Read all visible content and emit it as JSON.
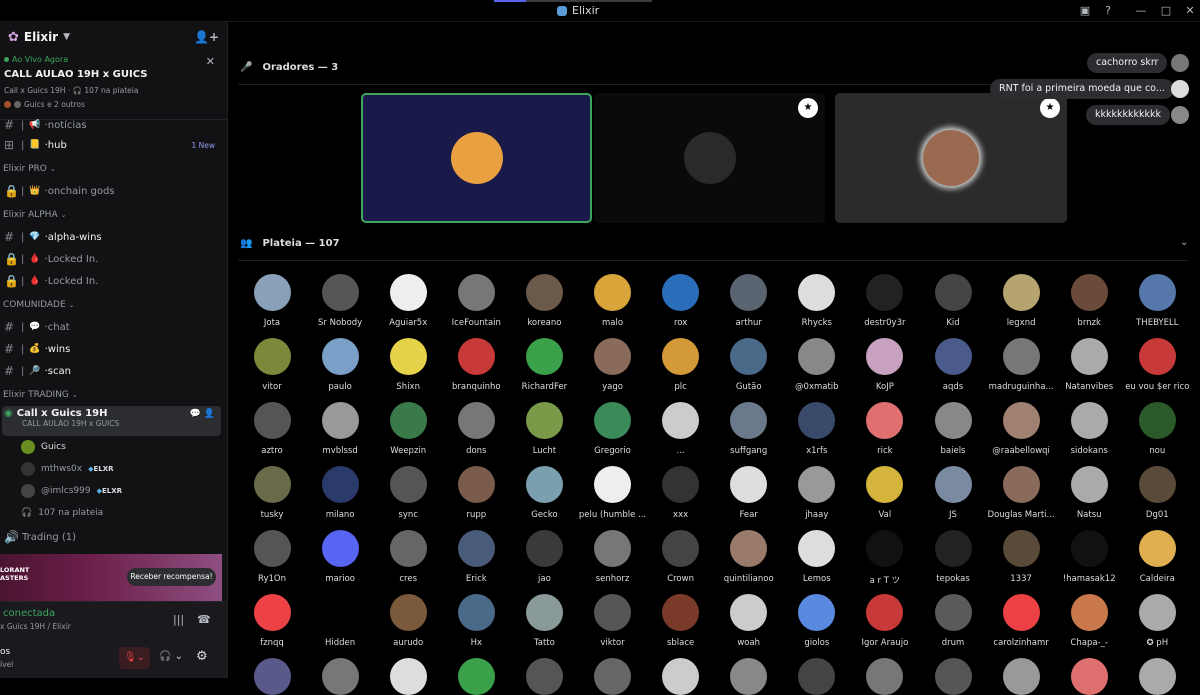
{
  "window": {
    "title": "Elixir",
    "min_icon": "minimize-icon",
    "max_icon": "maximize-icon",
    "close_icon": "close-icon",
    "help_icon": "help-icon"
  },
  "server": {
    "name": "Elixir"
  },
  "live_banner": {
    "label": "Ao Vivo Agora",
    "title": "CALL AULAO 19H x GUICS",
    "meta": "Call x Guics 19H  ·  🎧 107 na plateia",
    "meta2": "Guics e 2 outros"
  },
  "channels_top": [
    {
      "name": "notícias",
      "emoji": "📢"
    },
    {
      "name": "hub",
      "emoji": "📒",
      "badge": "1 New"
    }
  ],
  "cat_pro": {
    "name": "Elixir PRO"
  },
  "ch_pro": [
    {
      "name": "onchain gods",
      "emoji": "👑"
    }
  ],
  "cat_alpha": {
    "name": "Elixir ALPHA"
  },
  "ch_alpha": [
    {
      "name": "alpha-wins",
      "emoji": "💎"
    },
    {
      "name": "Locked In.",
      "emoji": "🩸"
    },
    {
      "name": "Locked In.",
      "emoji": "🩸"
    }
  ],
  "cat_com": {
    "name": "COMUNIDADE"
  },
  "ch_com": [
    {
      "name": "chat",
      "emoji": "💬"
    },
    {
      "name": "wins",
      "emoji": "💰"
    },
    {
      "name": "scan",
      "emoji": "🔎"
    }
  ],
  "cat_trading": {
    "name": "Elixir TRADING"
  },
  "voice_channel": {
    "name": "Call x Guics 19H",
    "sub": "CALL AULAO 19H x GUICS"
  },
  "voice_users": [
    {
      "name": "Guics",
      "tag": "",
      "color": "#6b8e23"
    },
    {
      "name": "mthws0x",
      "tag": "ELXR",
      "color": "#333"
    },
    {
      "name": "@imlcs999",
      "tag": "ELXR",
      "color": "#444"
    }
  ],
  "audience_count": "107 na plateia",
  "trading_channel": "Trading (1)",
  "promo": {
    "text": "LORANT\nASTERS",
    "button": "Receber recompensa!"
  },
  "connection": {
    "status": "conectada",
    "detail": "x Guics 19H / Elixir"
  },
  "user": {
    "name": "os",
    "status": "ível"
  },
  "speakers_header": "Oradores — 3",
  "audience_header": "Plateia — 107",
  "chat": [
    {
      "text": "cachorro skrr",
      "color": "#777"
    },
    {
      "text": "RNT foi a primeira moeda que co...",
      "color": "#ddd"
    },
    {
      "text": "kkkkkkkkkkkk",
      "color": "#888"
    }
  ],
  "audience": [
    [
      "Jota",
      "#8aa0b8"
    ],
    [
      "Sr Nobody",
      "#555"
    ],
    [
      "Aguiar5x",
      "#eee"
    ],
    [
      "IceFountain",
      "#777"
    ],
    [
      "koreano",
      "#6b5a4a"
    ],
    [
      "malo",
      "#d9a53a"
    ],
    [
      "rox",
      "#2a6ebb"
    ],
    [
      "arthur",
      "#5a6470"
    ],
    [
      "Rhycks",
      "#ddd"
    ],
    [
      "destr0y3r",
      "#222"
    ],
    [
      "Kid",
      "#444"
    ],
    [
      "legxnd",
      "#b5a470"
    ],
    [
      "brnzk",
      "#6a4a3a"
    ],
    [
      "THEBYELL",
      "#5577aa"
    ],
    [
      "vitor",
      "#7a8a3a"
    ],
    [
      "paulo",
      "#7aa0c8"
    ],
    [
      "Shixn",
      "#e6d24a"
    ],
    [
      "branquinho",
      "#c83a3a"
    ],
    [
      "RichardFer",
      "#3aa04a"
    ],
    [
      "yago",
      "#8a6a5a"
    ],
    [
      "plc",
      "#d49a3a"
    ],
    [
      "Gutão",
      "#4a6a8a"
    ],
    [
      "@0xmatib",
      "#888"
    ],
    [
      "KoJP",
      "#c8a0c0"
    ],
    [
      "aqds",
      "#4a5a8a"
    ],
    [
      "madruguinha...",
      "#777"
    ],
    [
      "Natanvibes",
      "#aaa"
    ],
    [
      "eu vou $er rico",
      "#c83a3a"
    ],
    [
      "aztro",
      "#555"
    ],
    [
      "mvblssd",
      "#999"
    ],
    [
      "Weepzin",
      "#3a7a4a"
    ],
    [
      "dons",
      "#777"
    ],
    [
      "Lucht",
      "#7a9a4a"
    ],
    [
      "Gregorio",
      "#3a8a5a"
    ],
    [
      "...",
      "#ccc"
    ],
    [
      "suffgang",
      "#6a7a8a"
    ],
    [
      "x1rfs",
      "#3a4a6a"
    ],
    [
      "rick",
      "#e07070"
    ],
    [
      "baiels",
      "#888"
    ],
    [
      "@raabellowqi",
      "#a08070"
    ],
    [
      "sidokans",
      "#aaa"
    ],
    [
      "nou",
      "#2a5a2a"
    ],
    [
      "tusky",
      "#6a6a4a"
    ],
    [
      "milano",
      "#2a3a6a"
    ],
    [
      "sync",
      "#555"
    ],
    [
      "rupp",
      "#7a5a4a"
    ],
    [
      "Gecko",
      "#7aa0b0"
    ],
    [
      "pelu (humble ...",
      "#eee"
    ],
    [
      "xxx",
      "#333"
    ],
    [
      "Fear",
      "#ddd"
    ],
    [
      "jhaay",
      "#999"
    ],
    [
      "Val",
      "#d4b43a"
    ],
    [
      "JS",
      "#7a8aa0"
    ],
    [
      "Douglas Marti...",
      "#8a6a5a"
    ],
    [
      "Natsu",
      "#aaa"
    ],
    [
      "Dg01",
      "#5a4a3a"
    ],
    [
      "Ry1On",
      "#555"
    ],
    [
      "marioo",
      "#5865f2"
    ],
    [
      "cres",
      "#666"
    ],
    [
      "Erick",
      "#4a5a7a"
    ],
    [
      "jao",
      "#3a3a3a"
    ],
    [
      "senhorz",
      "#777"
    ],
    [
      "Crown",
      "#444"
    ],
    [
      "quintilianoo",
      "#9a7a6a"
    ],
    [
      "Lemos",
      "#ddd"
    ],
    [
      "a r T ツ",
      "#111"
    ],
    [
      "tepokas",
      "#222"
    ],
    [
      "1337",
      "#5a4a3a"
    ],
    [
      "!hamasak12",
      "#111"
    ],
    [
      "Caldeira",
      "#e0b050"
    ],
    [
      "fznqq",
      "#ed4245"
    ],
    [
      "Hidden",
      "#000"
    ],
    [
      "aurudo",
      "#7a5a3a"
    ],
    [
      "Hx",
      "#4a6a8a"
    ],
    [
      "Tatto",
      "#8a9a9a"
    ],
    [
      "viktor",
      "#555"
    ],
    [
      "sblace",
      "#7a3a2a"
    ],
    [
      "woah",
      "#ccc"
    ],
    [
      "giolos",
      "#5a8ae0"
    ],
    [
      "Igor Araujo",
      "#c83a3a"
    ],
    [
      "drum",
      "#5a5a5a"
    ],
    [
      "carolzinhamr",
      "#ed4245"
    ],
    [
      "Chapa-_-",
      "#c8784a"
    ],
    [
      "✪ pH",
      "#aaa"
    ]
  ]
}
